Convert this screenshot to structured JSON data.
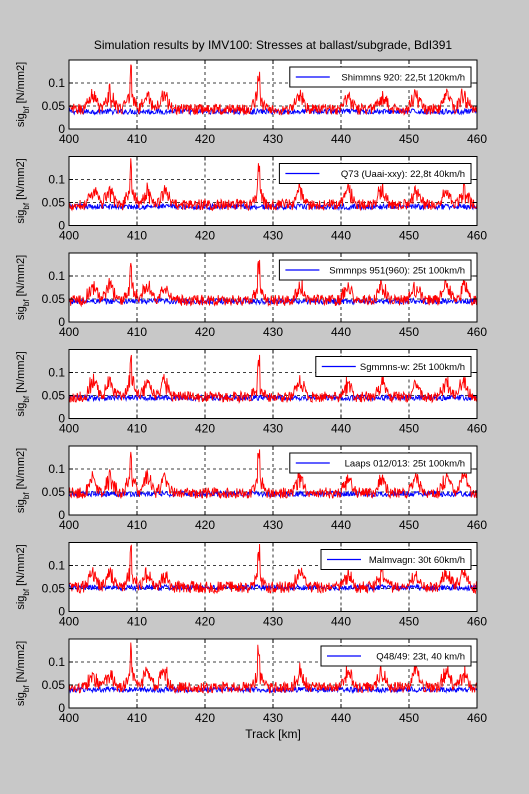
{
  "figure": {
    "title": "Simulation results by IMV100: Stresses at ballast/subgrade, BdI391",
    "xlabel": "Track [km]",
    "ylabel_main": "sig",
    "ylabel_sub": "bf",
    "ylabel_unit": " [N/mm2]"
  },
  "colors": {
    "background": "#c8c8c8",
    "axes": "#ffffff",
    "series_a": "#0000ff",
    "series_b": "#ff0000"
  },
  "chart_data": [
    {
      "type": "line",
      "legend": "Shimmns 920: 22,5t 120km/h",
      "xlim": [
        400,
        460
      ],
      "ylim": [
        0,
        0.15
      ],
      "xticks": [
        400,
        410,
        420,
        430,
        440,
        450,
        460
      ],
      "yticks": [
        0,
        0.05,
        0.1
      ],
      "ytick_labels": [
        "0",
        "0.05",
        "0.1"
      ],
      "grid": "dashed",
      "series": [
        {
          "color": "#0000ff",
          "mean": 0.038,
          "amp": 0.006,
          "spike": 0.004
        },
        {
          "color": "#ff0000",
          "mean": 0.043,
          "amp": 0.012,
          "spike": 0.05
        }
      ]
    },
    {
      "type": "line",
      "legend": "Q73 (Uaai-xxy): 22,8t 40km/h",
      "xlim": [
        400,
        460
      ],
      "ylim": [
        0,
        0.15
      ],
      "xticks": [
        400,
        410,
        420,
        430,
        440,
        450,
        460
      ],
      "yticks": [
        0,
        0.05,
        0.1
      ],
      "ytick_labels": [
        "0",
        "0.05",
        "0.1"
      ],
      "grid": "dashed",
      "series": [
        {
          "color": "#0000ff",
          "mean": 0.041,
          "amp": 0.006,
          "spike": 0.004
        },
        {
          "color": "#ff0000",
          "mean": 0.045,
          "amp": 0.012,
          "spike": 0.05
        }
      ]
    },
    {
      "type": "line",
      "legend": "Smmnps 951(960): 25t 100km/h",
      "xlim": [
        400,
        460
      ],
      "ylim": [
        0,
        0.15
      ],
      "xticks": [
        400,
        410,
        420,
        430,
        440,
        450,
        460
      ],
      "yticks": [
        0,
        0.05,
        0.1
      ],
      "ytick_labels": [
        "0",
        "0.05",
        "0.1"
      ],
      "grid": "dashed",
      "series": [
        {
          "color": "#0000ff",
          "mean": 0.045,
          "amp": 0.006,
          "spike": 0.004
        },
        {
          "color": "#ff0000",
          "mean": 0.047,
          "amp": 0.012,
          "spike": 0.05
        }
      ]
    },
    {
      "type": "line",
      "legend": "Sgmmns-w: 25t 100km/h",
      "xlim": [
        400,
        460
      ],
      "ylim": [
        0,
        0.15
      ],
      "xticks": [
        400,
        410,
        420,
        430,
        440,
        450,
        460
      ],
      "yticks": [
        0,
        0.05,
        0.1
      ],
      "ytick_labels": [
        "0",
        "0.05",
        "0.1"
      ],
      "grid": "dashed",
      "series": [
        {
          "color": "#0000ff",
          "mean": 0.045,
          "amp": 0.006,
          "spike": 0.004
        },
        {
          "color": "#ff0000",
          "mean": 0.047,
          "amp": 0.012,
          "spike": 0.05
        }
      ]
    },
    {
      "type": "line",
      "legend": "Laaps 012/013: 25t 100km/h",
      "xlim": [
        400,
        460
      ],
      "ylim": [
        0,
        0.15
      ],
      "xticks": [
        400,
        410,
        420,
        430,
        440,
        450,
        460
      ],
      "yticks": [
        0,
        0.05,
        0.1
      ],
      "ytick_labels": [
        "0",
        "0.05",
        "0.1"
      ],
      "grid": "dashed",
      "series": [
        {
          "color": "#0000ff",
          "mean": 0.046,
          "amp": 0.006,
          "spike": 0.004
        },
        {
          "color": "#ff0000",
          "mean": 0.048,
          "amp": 0.012,
          "spike": 0.05
        }
      ]
    },
    {
      "type": "line",
      "legend": "Malmvagn: 30t 60km/h",
      "xlim": [
        400,
        460
      ],
      "ylim": [
        0,
        0.15
      ],
      "xticks": [
        400,
        410,
        420,
        430,
        440,
        450,
        460
      ],
      "yticks": [
        0,
        0.05,
        0.1
      ],
      "ytick_labels": [
        "0",
        "0.05",
        "0.1"
      ],
      "grid": "dashed",
      "series": [
        {
          "color": "#0000ff",
          "mean": 0.052,
          "amp": 0.006,
          "spike": 0.004
        },
        {
          "color": "#ff0000",
          "mean": 0.053,
          "amp": 0.013,
          "spike": 0.045
        }
      ]
    },
    {
      "type": "line",
      "legend": "Q48/49: 23t, 40 km/h",
      "xlim": [
        400,
        460
      ],
      "ylim": [
        0,
        0.15
      ],
      "xticks": [
        400,
        410,
        420,
        430,
        440,
        450,
        460
      ],
      "yticks": [
        0,
        0.05,
        0.1
      ],
      "ytick_labels": [
        "0",
        "0.05",
        "0.1"
      ],
      "grid": "dashed",
      "series": [
        {
          "color": "#0000ff",
          "mean": 0.04,
          "amp": 0.006,
          "spike": 0.004
        },
        {
          "color": "#ff0000",
          "mean": 0.045,
          "amp": 0.012,
          "spike": 0.05
        }
      ]
    }
  ]
}
